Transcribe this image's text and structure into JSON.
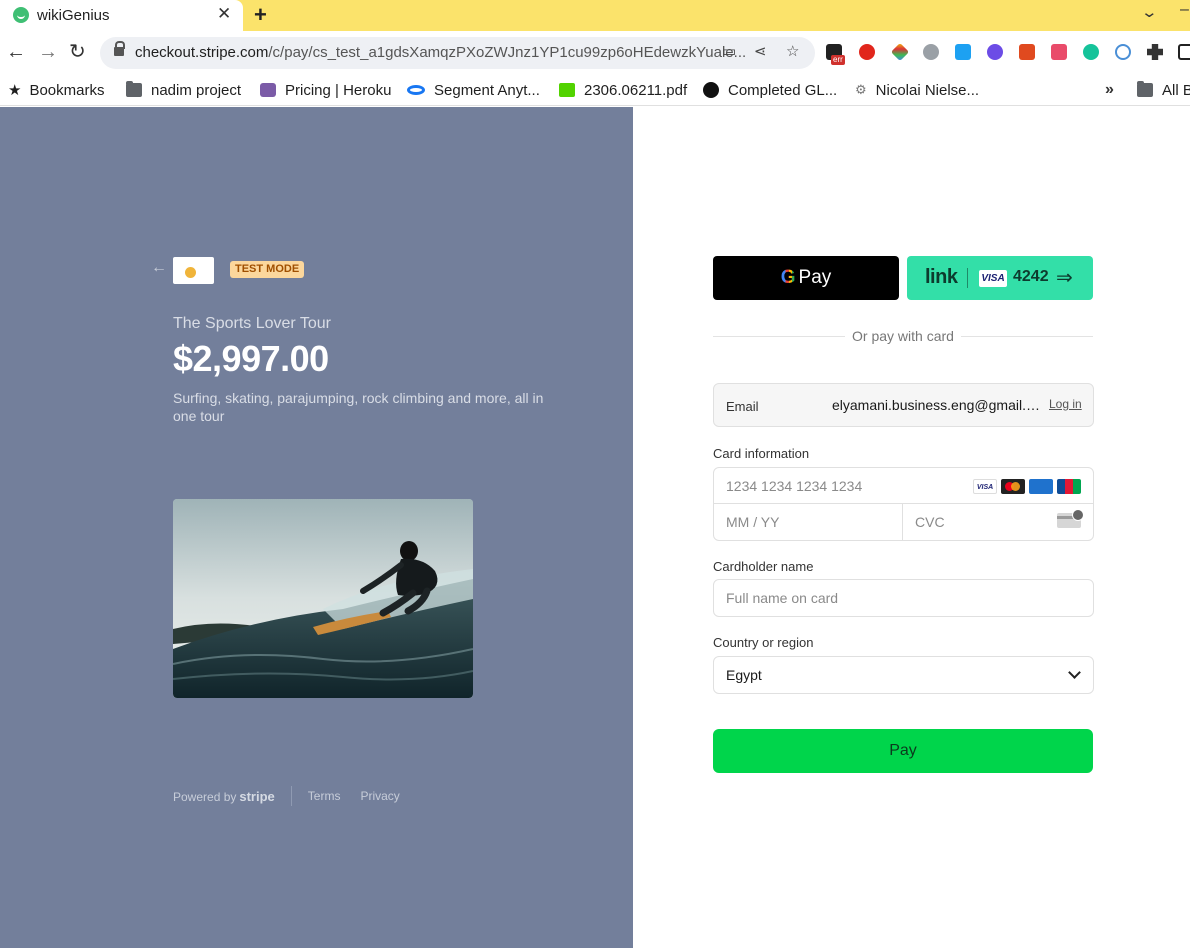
{
  "browser": {
    "tab_title": "wikiGenius",
    "url_host": "checkout.stripe.com",
    "url_path": "/c/pay/cs_test_a1gdsXamqzPXoZWJnz1YP1cu99zp6oHEdewzkYuale...",
    "ext_badge": "err",
    "bookmarks": [
      {
        "label": "Bookmarks",
        "icon": "star-icon"
      },
      {
        "label": "nadim project",
        "icon": "folder-icon"
      },
      {
        "label": "Pricing | Heroku",
        "icon": "heroku-icon"
      },
      {
        "label": "Segment Anyt...",
        "icon": "meta-icon"
      },
      {
        "label": "2306.06211.pdf",
        "icon": "smiley-icon"
      },
      {
        "label": "Completed GL...",
        "icon": "circle-icon"
      },
      {
        "label": "Nicolai Nielse...",
        "icon": "gear-icon"
      }
    ],
    "bookmarks_more": "»",
    "all_bookmarks": "All B"
  },
  "product": {
    "test_mode": "TEST MODE",
    "name": "The Sports Lover Tour",
    "price": "$2,997.00",
    "description": "Surfing, skating, parajumping, rock climbing and more, all in one tour"
  },
  "footer": {
    "powered_by": "Powered by",
    "stripe": "stripe",
    "terms": "Terms",
    "privacy": "Privacy"
  },
  "payment": {
    "gpay_g": "G",
    "gpay_label": "Pay",
    "link_label": "link",
    "link_card_brand": "VISA",
    "link_last4": "4242",
    "or_text": "Or pay with card",
    "email_label": "Email",
    "email_value": "elyamani.business.eng@gmail.com",
    "login_label": "Log in",
    "card_label": "Card information",
    "card_number_placeholder": "1234 1234 1234 1234",
    "expiry_placeholder": "MM / YY",
    "cvc_placeholder": "CVC",
    "card_brands": [
      "VISA",
      "MC",
      "AMEX",
      "JCB"
    ],
    "name_label": "Cardholder name",
    "name_placeholder": "Full name on card",
    "country_label": "Country or region",
    "country_value": "Egypt",
    "pay_label": "Pay"
  },
  "colors": {
    "left_panel_bg": "#737f9b",
    "pay_button": "#00d54b",
    "link_button": "#33dfa8",
    "tabbar": "#fbe36b"
  }
}
